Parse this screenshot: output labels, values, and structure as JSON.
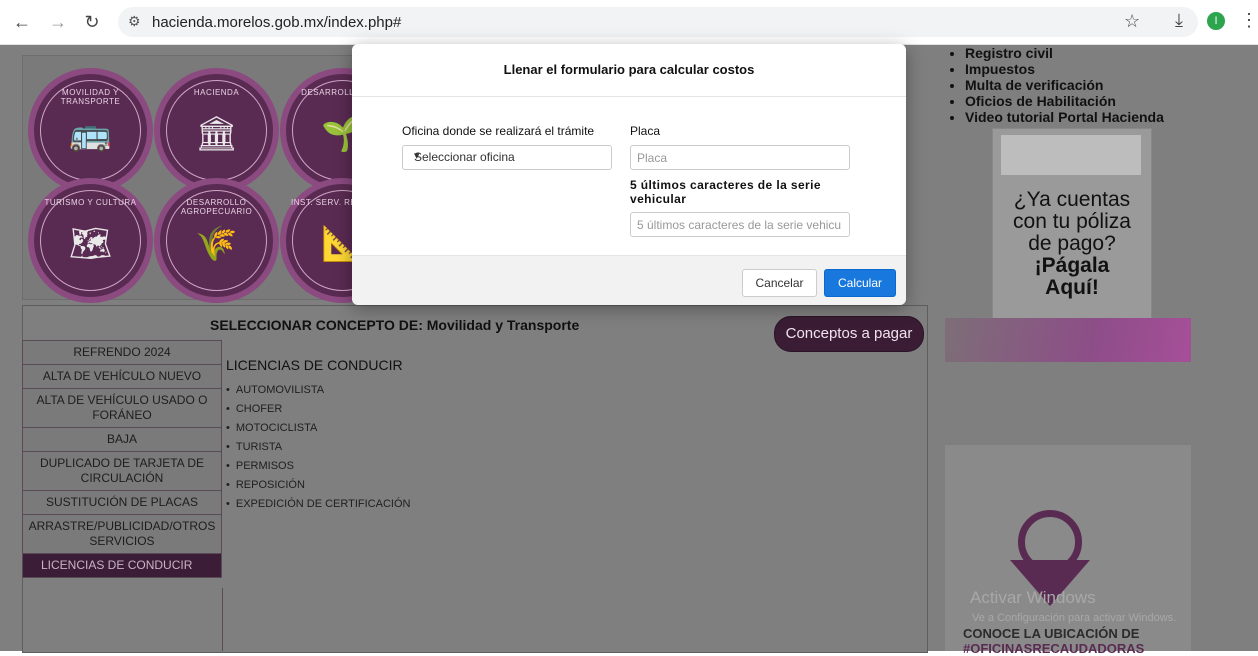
{
  "browser": {
    "url": "hacienda.morelos.gob.mx/index.php#",
    "avatar_letter": "I"
  },
  "icons": [
    "back-icon",
    "forward-icon",
    "reload-icon",
    "site-settings-icon",
    "bookmark-star-icon",
    "download-icon",
    "profile-avatar",
    "menu-kebab-icon"
  ],
  "circles": [
    {
      "label": "MOVILIDAD Y TRANSPORTE",
      "icon": "bus-icon",
      "glyph": "🚌"
    },
    {
      "label": "HACIENDA",
      "icon": "bank-icon",
      "glyph": "🏛"
    },
    {
      "label": "DESARROLLO SU...",
      "icon": "plant-hand-icon",
      "glyph": "🌱"
    },
    {
      "label": "TURISMO Y CULTURA",
      "icon": "map-pin-icon",
      "glyph": "🗺"
    },
    {
      "label": "DESARROLLO AGROPECUARIO",
      "icon": "farmer-icon",
      "glyph": "🌾"
    },
    {
      "label": "INST. SERV. REGISTRAL",
      "icon": "survey-icon",
      "glyph": "📐"
    }
  ],
  "right_links": [
    "Registro civil",
    "Impuestos",
    "Multa de verificación",
    "Oficios de Habilitación",
    "Video tutorial Portal Hacienda"
  ],
  "ad": {
    "line1": "¿Ya cuentas",
    "line2": "con tu póliza",
    "line3": "de pago?",
    "line4": "¡Págala",
    "line5": "Aquí!"
  },
  "map_card": {
    "line1": "CONOCE LA UBICACIÓN DE",
    "line2": "#OFICINASRECAUDADORAS"
  },
  "watermark": {
    "line1": "Activar Windows",
    "line2": "Ve a Configuración para activar Windows."
  },
  "concept": {
    "title": "SELECCIONAR CONCEPTO DE: Movilidad y Transporte",
    "button": "Conceptos a pagar",
    "side_items": [
      "REFRENDO 2024",
      "ALTA DE VEHÍCULO NUEVO",
      "ALTA DE VEHÍCULO USADO O FORÁNEO",
      "BAJA",
      "DUPLICADO DE TARJETA DE CIRCULACIÓN",
      "SUSTITUCIÓN DE PLACAS",
      "ARRASTRE/PUBLICIDAD/OTROS SERVICIOS",
      "LICENCIAS DE CONDUCIR"
    ],
    "active_index": 7,
    "section_title": "LICENCIAS DE CONDUCIR",
    "licenses": [
      "AUTOMOVILISTA",
      "CHOFER",
      "MOTOCICLISTA",
      "TURISTA",
      "PERMISOS",
      "REPOSICIÓN",
      "EXPEDICIÓN DE CERTIFICACIÓN"
    ]
  },
  "modal": {
    "title": "Llenar el formulario para calcular costos",
    "oficina_label": "Oficina donde se realizará el trámite",
    "oficina_value": "Seleccionar oficina",
    "placa_label": "Placa",
    "placa_placeholder": "Placa",
    "serie_label": "5 últimos caracteres de la serie vehicular",
    "serie_placeholder": "5 últimos caracteres de la serie vehicu",
    "cancel": "Cancelar",
    "calc": "Calcular"
  }
}
